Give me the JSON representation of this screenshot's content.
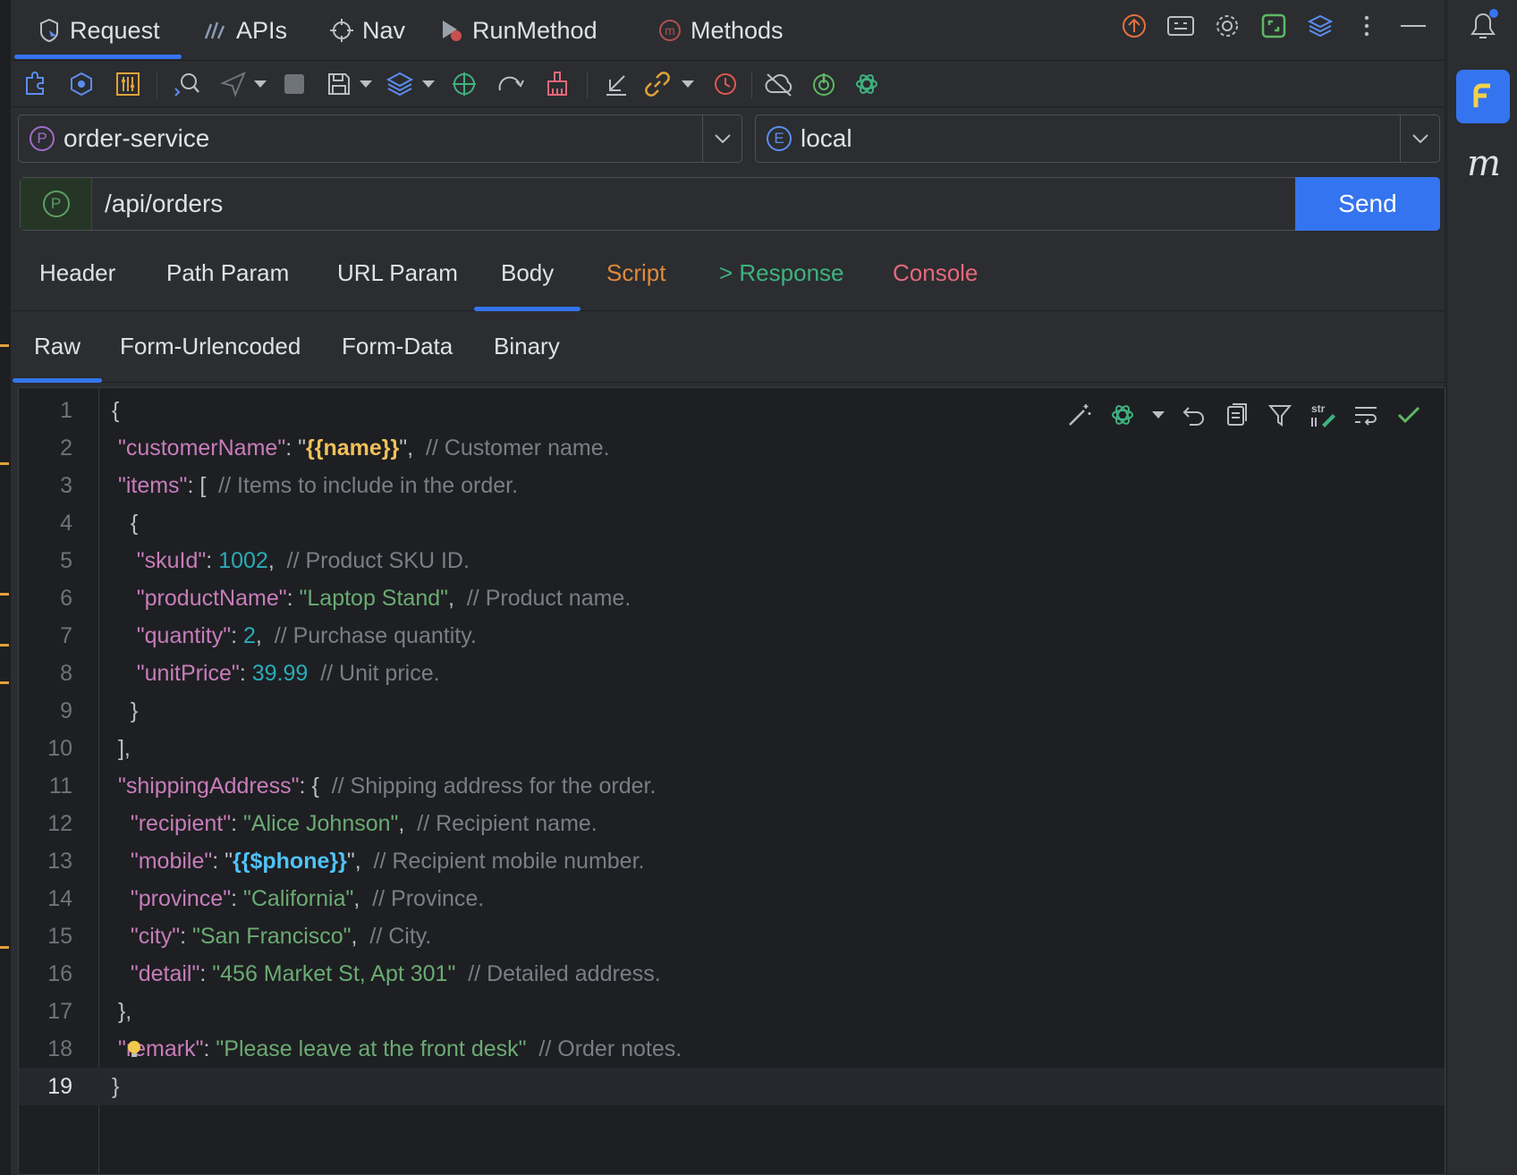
{
  "top_tabs": [
    {
      "label": "Request",
      "icon": "request-icon"
    },
    {
      "label": "APIs",
      "icon": "apis-icon"
    },
    {
      "label": "Nav",
      "icon": "crosshair-icon"
    },
    {
      "label": "RunMethod",
      "icon": "run-method-icon"
    },
    {
      "label": "Methods",
      "icon": "methods-icon"
    }
  ],
  "project_select": {
    "badge": "P",
    "value": "order-service"
  },
  "env_select": {
    "badge": "E",
    "value": "local"
  },
  "url": {
    "method_badge": "P",
    "value": "/api/orders",
    "send_label": "Send"
  },
  "request_tabs": [
    {
      "label": "Header",
      "color": "#dfe1e5"
    },
    {
      "label": "Path Param",
      "color": "#dfe1e5"
    },
    {
      "label": "URL Param",
      "color": "#dfe1e5"
    },
    {
      "label": "Body",
      "color": "#dfe1e5"
    },
    {
      "label": "Script",
      "color": "#e08a3c"
    },
    {
      "label": "> Response",
      "color": "#3fb27f"
    },
    {
      "label": "Console",
      "color": "#e5687a"
    }
  ],
  "active_request_tab": "Body",
  "body_tabs": [
    "Raw",
    "Form-Urlencoded",
    "Form-Data",
    "Binary"
  ],
  "active_body_tab": "Raw",
  "editor": {
    "line_numbers": [
      "1",
      "2",
      "3",
      "4",
      "5",
      "6",
      "7",
      "8",
      "9",
      "10",
      "11",
      "12",
      "13",
      "14",
      "15",
      "16",
      "17",
      "18",
      "19"
    ],
    "current_line": "19",
    "lines": [
      [
        {
          "t": "p",
          "v": "{"
        }
      ],
      [
        {
          "t": "k",
          "v": " \"customerName\""
        },
        {
          "t": "p",
          "v": ": \""
        },
        {
          "t": "v1",
          "v": "{{name}}"
        },
        {
          "t": "p",
          "v": "\",  "
        },
        {
          "t": "c",
          "v": "// Customer name."
        }
      ],
      [
        {
          "t": "k",
          "v": " \"items\""
        },
        {
          "t": "p",
          "v": ": [  "
        },
        {
          "t": "c",
          "v": "// Items to include in the order."
        }
      ],
      [
        {
          "t": "p",
          "v": "   {"
        }
      ],
      [
        {
          "t": "k",
          "v": "    \"skuId\""
        },
        {
          "t": "p",
          "v": ": "
        },
        {
          "t": "n",
          "v": "1002"
        },
        {
          "t": "p",
          "v": ",  "
        },
        {
          "t": "c",
          "v": "// Product SKU ID."
        }
      ],
      [
        {
          "t": "k",
          "v": "    \"productName\""
        },
        {
          "t": "p",
          "v": ": "
        },
        {
          "t": "s",
          "v": "\"Laptop Stand\""
        },
        {
          "t": "p",
          "v": ",  "
        },
        {
          "t": "c",
          "v": "// Product name."
        }
      ],
      [
        {
          "t": "k",
          "v": "    \"quantity\""
        },
        {
          "t": "p",
          "v": ": "
        },
        {
          "t": "n",
          "v": "2"
        },
        {
          "t": "p",
          "v": ",  "
        },
        {
          "t": "c",
          "v": "// Purchase quantity."
        }
      ],
      [
        {
          "t": "k",
          "v": "    \"unitPrice\""
        },
        {
          "t": "p",
          "v": ": "
        },
        {
          "t": "n",
          "v": "39.99"
        },
        {
          "t": "p",
          "v": "  "
        },
        {
          "t": "c",
          "v": "// Unit price."
        }
      ],
      [
        {
          "t": "p",
          "v": "   }"
        }
      ],
      [
        {
          "t": "p",
          "v": " ],"
        }
      ],
      [
        {
          "t": "k",
          "v": " \"shippingAddress\""
        },
        {
          "t": "p",
          "v": ": {  "
        },
        {
          "t": "c",
          "v": "// Shipping address for the order."
        }
      ],
      [
        {
          "t": "k",
          "v": "   \"recipient\""
        },
        {
          "t": "p",
          "v": ": "
        },
        {
          "t": "s",
          "v": "\"Alice Johnson\""
        },
        {
          "t": "p",
          "v": ",  "
        },
        {
          "t": "c",
          "v": "// Recipient name."
        }
      ],
      [
        {
          "t": "k",
          "v": "   \"mobile\""
        },
        {
          "t": "p",
          "v": ": \""
        },
        {
          "t": "v2",
          "v": "{{$phone}}"
        },
        {
          "t": "p",
          "v": "\",  "
        },
        {
          "t": "c",
          "v": "// Recipient mobile number."
        }
      ],
      [
        {
          "t": "k",
          "v": "   \"province\""
        },
        {
          "t": "p",
          "v": ": "
        },
        {
          "t": "s",
          "v": "\"California\""
        },
        {
          "t": "p",
          "v": ",  "
        },
        {
          "t": "c",
          "v": "// Province."
        }
      ],
      [
        {
          "t": "k",
          "v": "   \"city\""
        },
        {
          "t": "p",
          "v": ": "
        },
        {
          "t": "s",
          "v": "\"San Francisco\""
        },
        {
          "t": "p",
          "v": ",  "
        },
        {
          "t": "c",
          "v": "// City."
        }
      ],
      [
        {
          "t": "k",
          "v": "   \"detail\""
        },
        {
          "t": "p",
          "v": ": "
        },
        {
          "t": "s",
          "v": "\"456 Market St, Apt 301\""
        },
        {
          "t": "p",
          "v": "  "
        },
        {
          "t": "c",
          "v": "// Detailed address."
        }
      ],
      [
        {
          "t": "p",
          "v": " },"
        }
      ],
      [
        {
          "t": "k",
          "v": " \"remark\""
        },
        {
          "t": "p",
          "v": ": "
        },
        {
          "t": "s",
          "v": "\"Please leave at the front desk\""
        },
        {
          "t": "p",
          "v": "  "
        },
        {
          "t": "c",
          "v": "// Order notes."
        }
      ],
      [
        {
          "t": "p",
          "v": "}"
        }
      ]
    ]
  },
  "colors": {
    "accent": "#3574f0",
    "bg": "#2b2d30",
    "editor_bg": "#1e1f22"
  }
}
